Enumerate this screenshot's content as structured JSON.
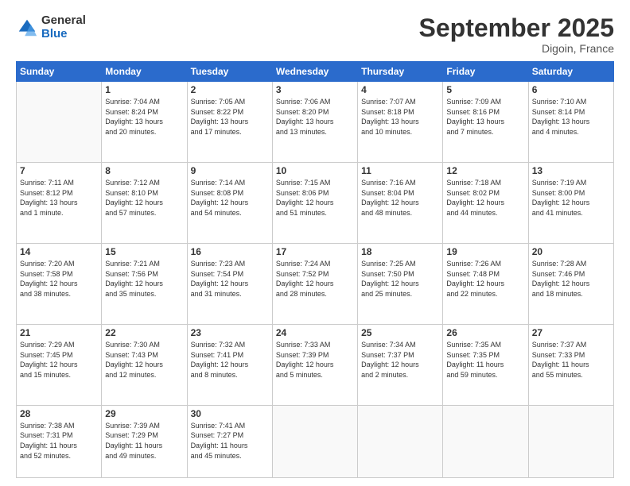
{
  "logo": {
    "general": "General",
    "blue": "Blue"
  },
  "title": {
    "month": "September 2025",
    "location": "Digoin, France"
  },
  "weekdays": [
    "Sunday",
    "Monday",
    "Tuesday",
    "Wednesday",
    "Thursday",
    "Friday",
    "Saturday"
  ],
  "weeks": [
    [
      {
        "num": "",
        "info": ""
      },
      {
        "num": "1",
        "info": "Sunrise: 7:04 AM\nSunset: 8:24 PM\nDaylight: 13 hours\nand 20 minutes."
      },
      {
        "num": "2",
        "info": "Sunrise: 7:05 AM\nSunset: 8:22 PM\nDaylight: 13 hours\nand 17 minutes."
      },
      {
        "num": "3",
        "info": "Sunrise: 7:06 AM\nSunset: 8:20 PM\nDaylight: 13 hours\nand 13 minutes."
      },
      {
        "num": "4",
        "info": "Sunrise: 7:07 AM\nSunset: 8:18 PM\nDaylight: 13 hours\nand 10 minutes."
      },
      {
        "num": "5",
        "info": "Sunrise: 7:09 AM\nSunset: 8:16 PM\nDaylight: 13 hours\nand 7 minutes."
      },
      {
        "num": "6",
        "info": "Sunrise: 7:10 AM\nSunset: 8:14 PM\nDaylight: 13 hours\nand 4 minutes."
      }
    ],
    [
      {
        "num": "7",
        "info": "Sunrise: 7:11 AM\nSunset: 8:12 PM\nDaylight: 13 hours\nand 1 minute."
      },
      {
        "num": "8",
        "info": "Sunrise: 7:12 AM\nSunset: 8:10 PM\nDaylight: 12 hours\nand 57 minutes."
      },
      {
        "num": "9",
        "info": "Sunrise: 7:14 AM\nSunset: 8:08 PM\nDaylight: 12 hours\nand 54 minutes."
      },
      {
        "num": "10",
        "info": "Sunrise: 7:15 AM\nSunset: 8:06 PM\nDaylight: 12 hours\nand 51 minutes."
      },
      {
        "num": "11",
        "info": "Sunrise: 7:16 AM\nSunset: 8:04 PM\nDaylight: 12 hours\nand 48 minutes."
      },
      {
        "num": "12",
        "info": "Sunrise: 7:18 AM\nSunset: 8:02 PM\nDaylight: 12 hours\nand 44 minutes."
      },
      {
        "num": "13",
        "info": "Sunrise: 7:19 AM\nSunset: 8:00 PM\nDaylight: 12 hours\nand 41 minutes."
      }
    ],
    [
      {
        "num": "14",
        "info": "Sunrise: 7:20 AM\nSunset: 7:58 PM\nDaylight: 12 hours\nand 38 minutes."
      },
      {
        "num": "15",
        "info": "Sunrise: 7:21 AM\nSunset: 7:56 PM\nDaylight: 12 hours\nand 35 minutes."
      },
      {
        "num": "16",
        "info": "Sunrise: 7:23 AM\nSunset: 7:54 PM\nDaylight: 12 hours\nand 31 minutes."
      },
      {
        "num": "17",
        "info": "Sunrise: 7:24 AM\nSunset: 7:52 PM\nDaylight: 12 hours\nand 28 minutes."
      },
      {
        "num": "18",
        "info": "Sunrise: 7:25 AM\nSunset: 7:50 PM\nDaylight: 12 hours\nand 25 minutes."
      },
      {
        "num": "19",
        "info": "Sunrise: 7:26 AM\nSunset: 7:48 PM\nDaylight: 12 hours\nand 22 minutes."
      },
      {
        "num": "20",
        "info": "Sunrise: 7:28 AM\nSunset: 7:46 PM\nDaylight: 12 hours\nand 18 minutes."
      }
    ],
    [
      {
        "num": "21",
        "info": "Sunrise: 7:29 AM\nSunset: 7:45 PM\nDaylight: 12 hours\nand 15 minutes."
      },
      {
        "num": "22",
        "info": "Sunrise: 7:30 AM\nSunset: 7:43 PM\nDaylight: 12 hours\nand 12 minutes."
      },
      {
        "num": "23",
        "info": "Sunrise: 7:32 AM\nSunset: 7:41 PM\nDaylight: 12 hours\nand 8 minutes."
      },
      {
        "num": "24",
        "info": "Sunrise: 7:33 AM\nSunset: 7:39 PM\nDaylight: 12 hours\nand 5 minutes."
      },
      {
        "num": "25",
        "info": "Sunrise: 7:34 AM\nSunset: 7:37 PM\nDaylight: 12 hours\nand 2 minutes."
      },
      {
        "num": "26",
        "info": "Sunrise: 7:35 AM\nSunset: 7:35 PM\nDaylight: 11 hours\nand 59 minutes."
      },
      {
        "num": "27",
        "info": "Sunrise: 7:37 AM\nSunset: 7:33 PM\nDaylight: 11 hours\nand 55 minutes."
      }
    ],
    [
      {
        "num": "28",
        "info": "Sunrise: 7:38 AM\nSunset: 7:31 PM\nDaylight: 11 hours\nand 52 minutes."
      },
      {
        "num": "29",
        "info": "Sunrise: 7:39 AM\nSunset: 7:29 PM\nDaylight: 11 hours\nand 49 minutes."
      },
      {
        "num": "30",
        "info": "Sunrise: 7:41 AM\nSunset: 7:27 PM\nDaylight: 11 hours\nand 45 minutes."
      },
      {
        "num": "",
        "info": ""
      },
      {
        "num": "",
        "info": ""
      },
      {
        "num": "",
        "info": ""
      },
      {
        "num": "",
        "info": ""
      }
    ]
  ]
}
